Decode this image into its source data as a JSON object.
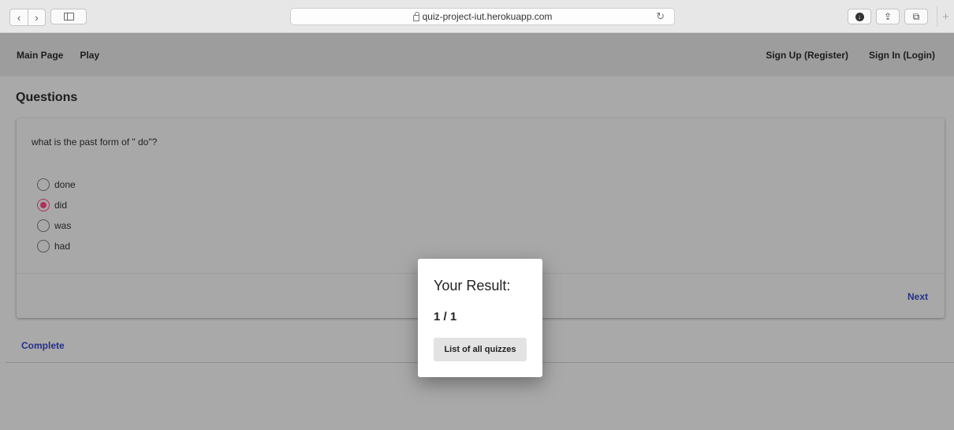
{
  "browser": {
    "url": "quiz-project-iut.herokuapp.com",
    "back_glyph": "‹",
    "forward_glyph": "›",
    "reload_glyph": "↻",
    "share_glyph": "⇪",
    "tabs_glyph": "⧉",
    "newtab_glyph": "+"
  },
  "navbar": {
    "main_page": "Main Page",
    "play": "Play",
    "sign_up": "Sign Up (Register)",
    "sign_in": "Sign In (Login)"
  },
  "page": {
    "title": "Questions"
  },
  "question": {
    "text": "what is the past form of \" do\"?",
    "options": [
      {
        "label": "done",
        "selected": false
      },
      {
        "label": "did",
        "selected": true
      },
      {
        "label": "was",
        "selected": false
      },
      {
        "label": "had",
        "selected": false
      }
    ],
    "next_label": "Next"
  },
  "complete_label": "Complete",
  "modal": {
    "title": "Your Result:",
    "score": "1 / 1",
    "button_label": "List of all quizzes"
  },
  "colors": {
    "accent_link": "#24308a",
    "radio_selected": "#b0305a"
  }
}
